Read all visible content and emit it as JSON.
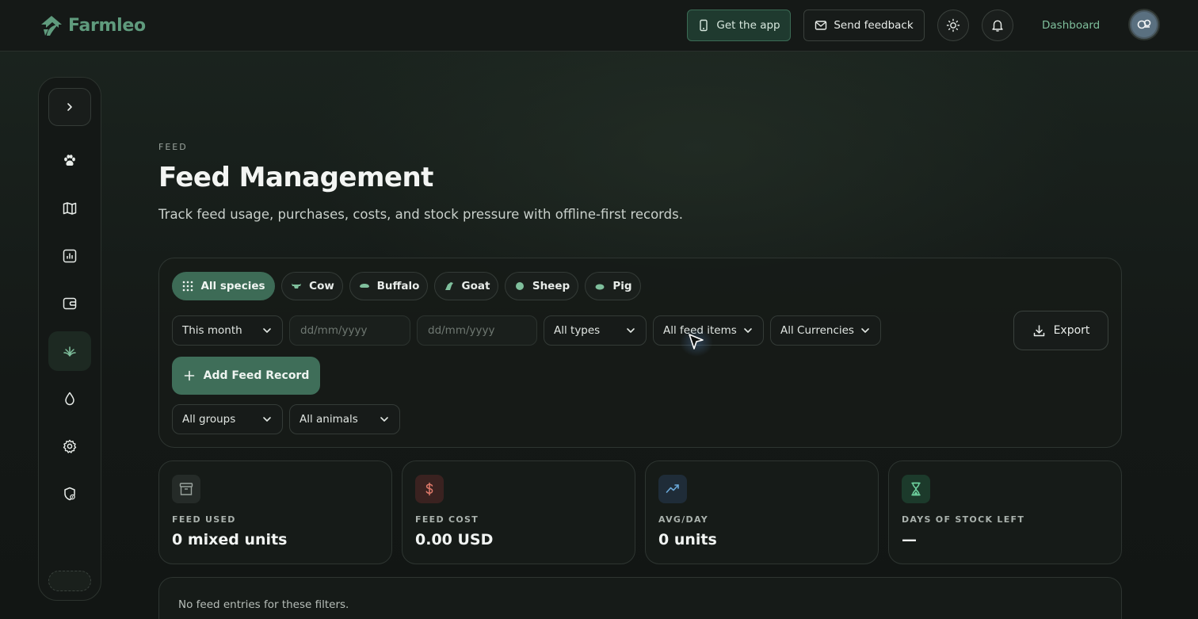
{
  "brand": {
    "name": "Farmleo",
    "color": "#5f9b7d"
  },
  "topbar": {
    "get_app": "Get the app",
    "send_feedback": "Send feedback",
    "dashboard": "Dashboard"
  },
  "header": {
    "eyebrow": "FEED",
    "title": "Feed Management",
    "subtitle": "Track feed usage, purchases, costs, and stock pressure with offline-first records."
  },
  "species": [
    {
      "label": "All species",
      "active": true
    },
    {
      "label": "Cow"
    },
    {
      "label": "Buffalo"
    },
    {
      "label": "Goat"
    },
    {
      "label": "Sheep"
    },
    {
      "label": "Pig"
    }
  ],
  "filters": {
    "period": "This month",
    "date_from_placeholder": "dd/mm/yyyy",
    "date_to_placeholder": "dd/mm/yyyy",
    "types": "All types",
    "feed_items": "All feed items",
    "currencies": "All Currencies",
    "groups": "All groups",
    "animals": "All animals"
  },
  "actions": {
    "export": "Export",
    "add_record": "Add Feed Record"
  },
  "stats": [
    {
      "label": "FEED USED",
      "value": "0 mixed units",
      "accent": "#9aa39d"
    },
    {
      "label": "FEED COST",
      "value": "0.00 USD",
      "accent": "#e07a6a"
    },
    {
      "label": "AVG/DAY",
      "value": "0 units",
      "accent": "#6aa8d8"
    },
    {
      "label": "DAYS OF STOCK LEFT",
      "value": "—",
      "accent": "#6fd3a0"
    }
  ],
  "list": {
    "empty": "No feed entries for these filters."
  }
}
